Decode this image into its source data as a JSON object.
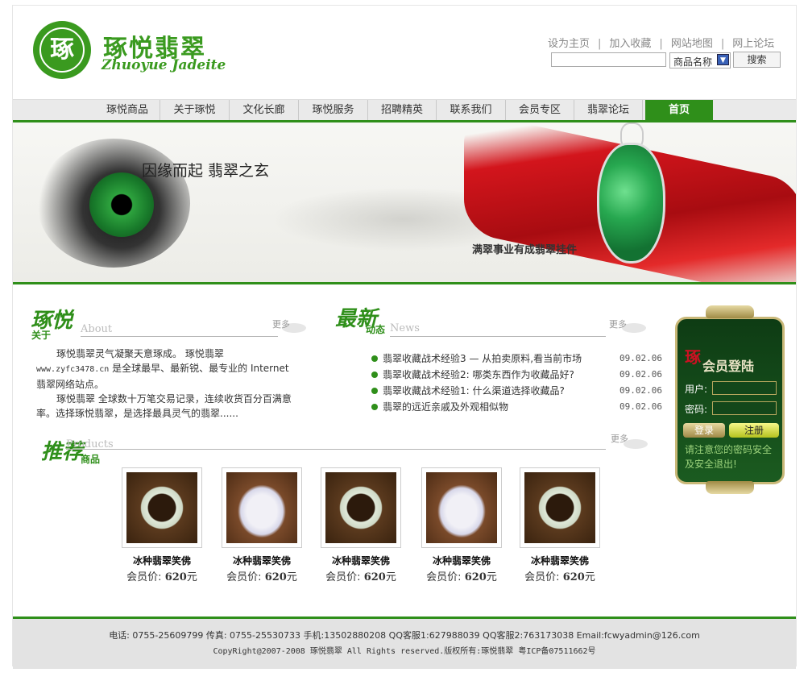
{
  "header": {
    "logo_text_cn": "琢悦翡翠",
    "logo_text_en": "Zhuoyue Jadeite",
    "top_links": [
      "设为主页",
      "加入收藏",
      "网站地图",
      "网上论坛"
    ],
    "search_placeholder": "",
    "search_select_value": "商品名称",
    "search_button": "搜索"
  },
  "nav": {
    "items": [
      "琢悦商品",
      "关于琢悦",
      "文化长廊",
      "琢悦服务",
      "招聘精英",
      "联系我们",
      "会员专区",
      "翡翠论坛",
      "首页"
    ]
  },
  "banner": {
    "calligraphy": "因缘而起 翡翠之玄",
    "caption": "满翠事业有成翡翠挂件"
  },
  "about": {
    "title_big": "琢悦",
    "title_small": "关于",
    "title_en": "About",
    "more": "更多",
    "para1_a": "琢悦翡翠灵气凝聚天意琢成。 琢悦翡翠",
    "para1_url": "www.zyfc3478.cn",
    "para1_b": " 是全球最早、最新锐、最专业的 Internet 翡翠网络站点。",
    "para2": "琢悦翡翠 全球数十万笔交易记录，连续收货百分百满意率。选择琢悦翡翠，是选择最具灵气的翡翠......"
  },
  "news": {
    "title_big": "最新",
    "title_small": "动态",
    "title_en": "News",
    "more": "更多",
    "items": [
      {
        "title": "翡翠收藏战术经验3 — 从拍卖原料,看当前市场",
        "date": "09.02.06"
      },
      {
        "title": "翡翠收藏战术经验2: 哪类东西作为收藏品好?",
        "date": "09.02.06"
      },
      {
        "title": "翡翠收藏战术经验1: 什么渠道选择收藏品?",
        "date": "09.02.06"
      },
      {
        "title": "翡翠的远近亲戚及外观相似物",
        "date": "09.02.06"
      }
    ]
  },
  "products": {
    "title_big": "推荐",
    "title_small": "商品",
    "title_en": "Products",
    "more": "更多",
    "items": [
      {
        "name": "冰种翡翠笑佛",
        "price_label": "会员价:",
        "price": "620",
        "unit": "元",
        "image": "bangle"
      },
      {
        "name": "冰种翡翠笑佛",
        "price_label": "会员价:",
        "price": "620",
        "unit": "元",
        "image": "buddha"
      },
      {
        "name": "冰种翡翠笑佛",
        "price_label": "会员价:",
        "price": "620",
        "unit": "元",
        "image": "bangle"
      },
      {
        "name": "冰种翡翠笑佛",
        "price_label": "会员价:",
        "price": "620",
        "unit": "元",
        "image": "buddha"
      },
      {
        "name": "冰种翡翠笑佛",
        "price_label": "会员价:",
        "price": "620",
        "unit": "元",
        "image": "bangle"
      }
    ]
  },
  "login": {
    "title": "会员登陆",
    "seal": "琢",
    "user_label": "用户:",
    "pass_label": "密码:",
    "login_button": "登录",
    "register_button": "注册",
    "note": "请注意您的密码安全及安全退出!"
  },
  "footer": {
    "line1": "电话: 0755-25609799 传真: 0755-25530733 手机:13502880208 QQ客服1:627988039 QQ客服2:763173038 Email:fcwyadmin@126.com",
    "line2": "CopyRight@2007-2008 琢悦翡翠 All Rights reserved.版权所有:琢悦翡翠 粤ICP备07511662号"
  },
  "colors": {
    "brand_green": "#2f8f1a",
    "login_bg": "#0e3c14",
    "login_border": "#c9b878"
  }
}
